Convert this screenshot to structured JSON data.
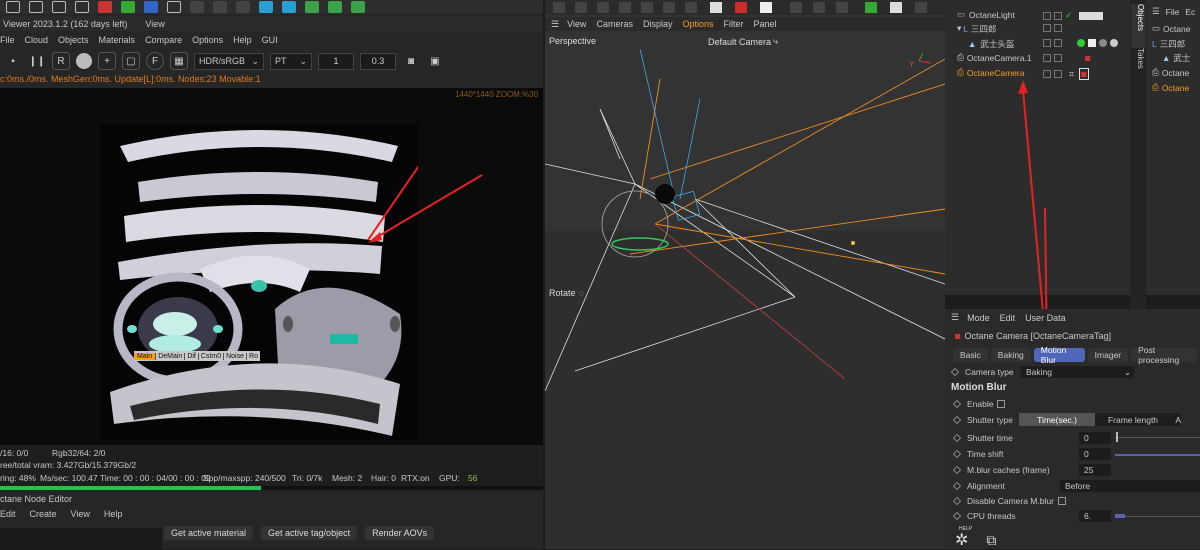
{
  "left": {
    "titlebar": {
      "viewer_title": "Viewer 2023.1.2 (162 days left)",
      "view_label": "View"
    },
    "menu": [
      "File",
      "Cloud",
      "Objects",
      "Materials",
      "Compare",
      "Options",
      "Help",
      "GUI"
    ],
    "toolbar": {
      "button_r": "R",
      "button_f": "F",
      "colorspace": "HDR/sRGB",
      "kernel": "PT",
      "value1": "1",
      "value2": "0.3"
    },
    "status_line": "c:0ms./0ms. MeshGen:0ms. Update[L]:0ms. Nodes:23 Movable:1",
    "resolution_line": "1440*1440 ZOOM:%30",
    "overlay_tabs": [
      "Main",
      "DeMain",
      "Dif",
      "Cstm0",
      "Noise",
      "Ro"
    ],
    "info_lines": {
      "line1_a": "/16: 0/0",
      "line1_b": "Rgb32/64: 2/0",
      "line2": "ree/total vram: 3.427Gb/15.379Gb/2",
      "line3_a": "ring: 48%",
      "line3_b": "Ms/sec: 100.47",
      "line3_c": "Time: 00 : 00 : 04/00 : 00 : 09",
      "line3_d": "Spp/maxspp: 240/500",
      "line3_e": "Tri: 0/7k",
      "line3_f": "Mesh: 2",
      "line3_g": "Hair: 0",
      "line3_h": "RTX:on",
      "line3_i": "GPU:",
      "line3_j": "56"
    },
    "render_progress": 0.48,
    "node_editor": {
      "title": "ctane Node Editor",
      "menu": [
        "Edit",
        "Create",
        "View",
        "Help"
      ],
      "buttons": [
        "Get active material",
        "Get active tag/object",
        "Render AOVs"
      ]
    }
  },
  "viewport": {
    "menu": [
      "View",
      "Cameras",
      "Display",
      "Options",
      "Filter",
      "Panel"
    ],
    "active_menu": "Options",
    "mode": "Perspective",
    "camera": "Default Camera",
    "rotate_label": "Rotate"
  },
  "objects": {
    "items": [
      {
        "name": "OctaneLight",
        "indent": 0
      },
      {
        "name": "三四郎",
        "indent": 0
      },
      {
        "name": "武士头盔",
        "indent": 1
      },
      {
        "name": "OctaneCamera.1",
        "indent": 0
      },
      {
        "name": "OctaneCamera",
        "indent": 0,
        "selected": true
      }
    ],
    "side_tabs": [
      "Objects",
      "Takes"
    ],
    "far_right_menu": [
      "File",
      "Ec"
    ],
    "far_right_items": [
      "Octane",
      "三四郎",
      "武士",
      "Octane",
      "Octane"
    ]
  },
  "attributes": {
    "menu": [
      "Mode",
      "Edit",
      "User Data"
    ],
    "header": "Octane Camera [OctaneCameraTag]",
    "tabs": [
      "Basic",
      "Baking",
      "Motion Blur",
      "Imager",
      "Post processing"
    ],
    "active_tab": "Motion Blur",
    "camera_type_label": "Camera type",
    "camera_type_value": "Baking",
    "section": "Motion Blur",
    "enable_label": "Enable",
    "shutter_type_label": "Shutter type",
    "shutter_options": [
      "Time(sec.)",
      "Frame length",
      "A"
    ],
    "shutter_time_label": "Shutter time",
    "shutter_time_value": "0",
    "time_shift_label": "Time shift",
    "time_shift_value": "0",
    "cache_label": "M.blur caches (frame)",
    "cache_value": "25",
    "alignment_label": "Alignment",
    "alignment_value": "Before",
    "disable_label": "Disable Camera M.blur",
    "cpu_label": "CPU threads",
    "cpu_value": "6.",
    "help_label": "HELP"
  },
  "colors": {
    "accent_blue": "#4e67b8",
    "selected_orange": "#f0a020",
    "arrow_red": "#e52222",
    "progress_green": "#23c24b"
  }
}
